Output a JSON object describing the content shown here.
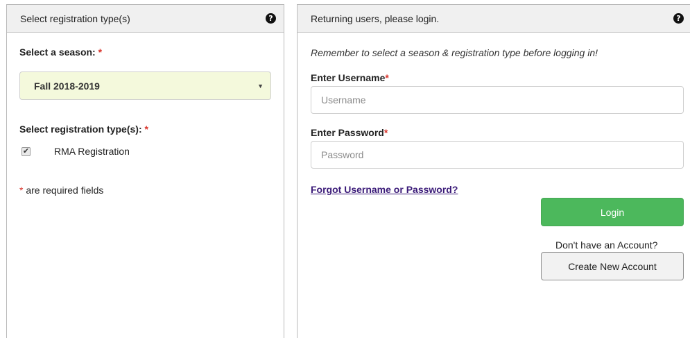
{
  "left_panel": {
    "title": "Select registration type(s)",
    "help_icon": "question-circle-icon",
    "season_label": "Select a season:",
    "season_required_mark": "*",
    "season_select": {
      "selected": "Fall 2018-2019",
      "caret": "▼"
    },
    "regtype_label": "Select registration type(s):",
    "regtype_required_mark": "*",
    "regtypes": [
      {
        "label": "RMA Registration",
        "checked": true
      }
    ],
    "required_note_mark": "*",
    "required_note": "are required fields"
  },
  "right_panel": {
    "title": "Returning users, please login.",
    "help_icon": "question-circle-icon",
    "reminder": "Remember to select a season & registration type before logging in!",
    "username_label": "Enter Username",
    "username_required_mark": "*",
    "username_placeholder": "Username",
    "password_label": "Enter Password",
    "password_required_mark": "*",
    "password_placeholder": "Password",
    "forgot_link": "Forgot Username or Password?",
    "login_button": "Login",
    "no_account_text": "Don't have an Account?",
    "create_account_button": "Create New Account"
  },
  "colors": {
    "required": "#d9342b",
    "login_button": "#4cb85c",
    "season_select_bg": "#f4f9dc",
    "link": "#3a1a78"
  }
}
